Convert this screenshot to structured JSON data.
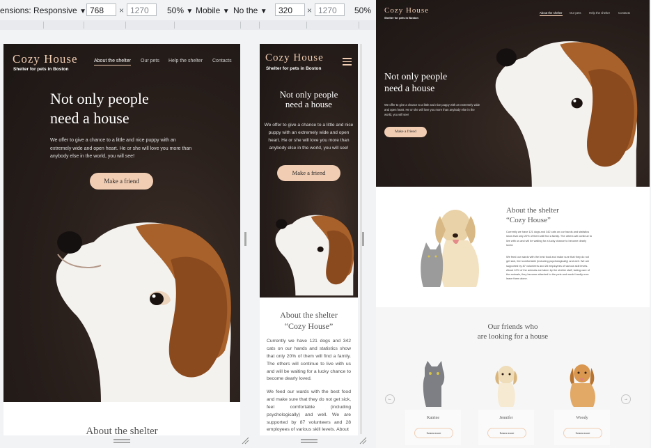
{
  "devtools": {
    "left": {
      "dimensions_label": "ensions: Responsive",
      "width": "768",
      "height": "1270",
      "zoom": "50%",
      "device": "Mobile",
      "throttle": "No the"
    },
    "right": {
      "width": "320",
      "height": "1270",
      "zoom": "50%"
    },
    "times_sign": "×",
    "dropdown_glyph": "▼"
  },
  "site": {
    "logo": "Cozy House",
    "subtitle": "Shelter for pets in Boston",
    "nav": [
      "About the shelter",
      "Our pets",
      "Help the shelter",
      "Contacts"
    ],
    "hero_title_line1": "Not only people",
    "hero_title_line2": "need a house",
    "hero_text_tablet": "We offer to give a chance to a little and nice puppy with an extremely wide and open heart. He or she will love you more than anybody else in the world, you will see!",
    "hero_text_mobile": "We offer to give a chance to a little and nice puppy with an extremely wide and open heart. He or she will love you more than anybody else in the world, you will see!",
    "make_friend_label": "Make a friend",
    "about_title_line1": "About the shelter",
    "about_title_line2": "“Cozy House”",
    "about_p1": "Currently we have 121 dogs and 342 cats on our hands and statistics show that only 20% of them will find a family. The others will continue to live with us and will be waiting for a lucky chance to become dearly loved.",
    "about_p2": "We feed our wards with the best food and make sure that they do not get sick, feel comfortable (including psychologically) and well. We are supported by 87 volunteers and 28 employees of various skill levels. About 12% of the animals are taken by the shelter staff, taking care of the animals, they become attached to the pets and would hardly ever leave them alone.",
    "about_p2_mobile": "We feed our wards with the best food and make sure that they do not get sick, feel comfortable (including psychologically) and well. We are supported by 87 volunteers and 28 employees of various skill levels. About",
    "about_heading_tablet_cut": "About the shelter",
    "friends_title_line1": "Our friends who",
    "friends_title_line2": "are looking for a house",
    "pets": [
      {
        "name": "Katrine",
        "button": "Learn more"
      },
      {
        "name": "Jennifer",
        "button": "Learn more"
      },
      {
        "name": "Woody",
        "button": "Learn more"
      }
    ],
    "arrow_left": "←",
    "arrow_right": "→"
  },
  "colors": {
    "accent": "#f1cdb3",
    "hero_dark": "#2a201c",
    "devtools_bg": "#f1f3f4"
  }
}
